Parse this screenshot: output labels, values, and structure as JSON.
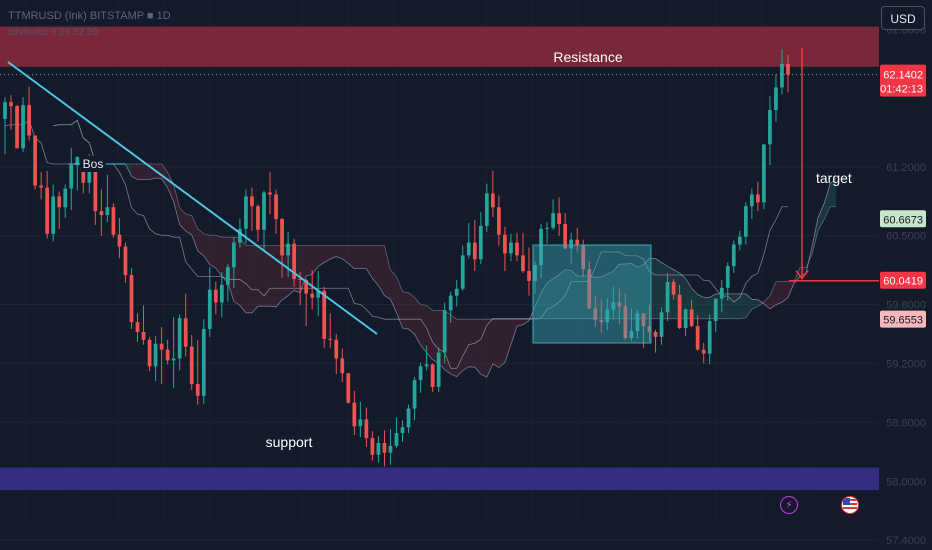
{
  "header": {
    "symbol_line": "TTMRUSD (Ink) BITSTAMP ■ 1D",
    "indicator_line": "Ichimoku 9 26 52 26"
  },
  "currency_button": "USD",
  "annotations": {
    "resistance": "Resistance",
    "support": "support",
    "bos": "Bos",
    "target": "target"
  },
  "price_labels": {
    "last": "62.1402",
    "countdown": "01:42:13",
    "line_a": "60.6673",
    "target_price": "60.0419",
    "line_b": "59.6553"
  },
  "bottom_icons": [
    "lightning-icon",
    "us-flag-icon"
  ],
  "colors": {
    "background": "#131a2a",
    "bull": "#26a69a",
    "bear": "#ef5350",
    "resistance_zone": "#8d2a3c",
    "support_zone": "#3a2f8a",
    "trendline": "#4fc3e4",
    "consolidation_box": "#3aa6b8",
    "target_marker": "#f23645",
    "label_green": "#c8e6c9",
    "label_red": "#f23645",
    "label_pink": "#f7b9b9"
  },
  "chart_data": {
    "type": "candlestick",
    "ylim": [
      57.3,
      62.9
    ],
    "resistance_zone": [
      62.22,
      62.63
    ],
    "support_zone": [
      57.91,
      58.14
    ],
    "target_level": 60.0419,
    "price_lines": [
      62.1402,
      60.6673,
      60.0419,
      59.6553
    ],
    "y_axis_ticks": [
      62.6,
      61.2,
      60.5,
      59.8,
      59.2,
      58.6,
      58.0,
      57.4
    ],
    "x_axis_ticks": [
      "",
      "",
      "",
      "",
      "",
      "",
      "",
      "",
      "",
      "",
      "",
      "",
      "",
      "",
      "",
      "",
      "",
      ""
    ],
    "candles_ohlc": [
      [
        61.69,
        61.91,
        61.33,
        61.86
      ],
      [
        61.86,
        61.93,
        61.58,
        61.82
      ],
      [
        61.82,
        61.83,
        61.41,
        61.39
      ],
      [
        61.39,
        61.91,
        61.35,
        61.83
      ],
      [
        61.83,
        62.02,
        61.47,
        61.52
      ],
      [
        61.52,
        61.52,
        60.97,
        61.01
      ],
      [
        61.01,
        61.15,
        60.87,
        60.99
      ],
      [
        60.99,
        61.16,
        60.47,
        60.52
      ],
      [
        60.52,
        61.02,
        60.44,
        60.9
      ],
      [
        60.9,
        60.95,
        60.57,
        60.79
      ],
      [
        60.79,
        61.02,
        60.68,
        60.98
      ],
      [
        60.98,
        61.39,
        60.76,
        61.22
      ],
      [
        61.22,
        61.31,
        60.96,
        61.3
      ],
      [
        61.3,
        61.3,
        60.93,
        61.04
      ],
      [
        61.04,
        61.33,
        60.93,
        61.2
      ],
      [
        61.2,
        61.24,
        60.61,
        60.75
      ],
      [
        60.75,
        60.97,
        60.5,
        60.71
      ],
      [
        60.71,
        61.12,
        60.64,
        60.79
      ],
      [
        60.79,
        60.83,
        60.48,
        60.51
      ],
      [
        60.51,
        60.68,
        60.27,
        60.39
      ],
      [
        60.39,
        60.43,
        60.02,
        60.1
      ],
      [
        60.1,
        60.17,
        59.55,
        59.62
      ],
      [
        59.62,
        59.71,
        59.42,
        59.52
      ],
      [
        59.52,
        59.79,
        59.39,
        59.44
      ],
      [
        59.44,
        59.47,
        59.12,
        59.17
      ],
      [
        59.17,
        59.48,
        59.02,
        59.4
      ],
      [
        59.4,
        59.57,
        58.99,
        59.34
      ],
      [
        59.34,
        59.44,
        59.19,
        59.23
      ],
      [
        59.23,
        59.67,
        58.95,
        59.25
      ],
      [
        59.25,
        59.7,
        59.13,
        59.66
      ],
      [
        59.66,
        59.91,
        59.27,
        59.37
      ],
      [
        59.37,
        59.49,
        58.93,
        58.99
      ],
      [
        58.99,
        59.44,
        58.78,
        58.87
      ],
      [
        58.87,
        59.65,
        58.79,
        59.55
      ],
      [
        59.55,
        60.18,
        59.47,
        59.95
      ],
      [
        59.95,
        60.03,
        59.7,
        59.82
      ],
      [
        59.82,
        60.13,
        59.67,
        60.0
      ],
      [
        60.0,
        60.21,
        59.83,
        60.18
      ],
      [
        60.18,
        60.49,
        59.97,
        60.43
      ],
      [
        60.43,
        60.67,
        60.38,
        60.57
      ],
      [
        60.57,
        60.97,
        60.42,
        60.9
      ],
      [
        60.9,
        60.99,
        60.55,
        60.8
      ],
      [
        60.8,
        60.82,
        60.44,
        60.56
      ],
      [
        60.56,
        60.96,
        60.36,
        60.94
      ],
      [
        60.94,
        61.15,
        60.72,
        60.92
      ],
      [
        60.92,
        60.97,
        60.52,
        60.67
      ],
      [
        60.67,
        60.68,
        60.07,
        60.3
      ],
      [
        60.3,
        60.54,
        60.08,
        60.42
      ],
      [
        60.42,
        60.47,
        59.98,
        60.06
      ],
      [
        60.06,
        60.13,
        59.79,
        60.05
      ],
      [
        60.05,
        60.06,
        59.58,
        59.91
      ],
      [
        59.91,
        60.15,
        59.75,
        59.87
      ],
      [
        59.87,
        60.14,
        59.68,
        59.94
      ],
      [
        59.94,
        59.98,
        59.36,
        59.45
      ],
      [
        59.45,
        59.71,
        59.36,
        59.44
      ],
      [
        59.44,
        59.5,
        59.09,
        59.25
      ],
      [
        59.25,
        59.35,
        59.01,
        59.1
      ],
      [
        59.1,
        59.1,
        58.79,
        58.8
      ],
      [
        58.8,
        58.92,
        58.47,
        58.56
      ],
      [
        58.56,
        58.81,
        58.45,
        58.63
      ],
      [
        58.63,
        58.75,
        58.35,
        58.44
      ],
      [
        58.44,
        58.51,
        58.21,
        58.27
      ],
      [
        58.27,
        58.46,
        58.19,
        58.39
      ],
      [
        58.39,
        58.52,
        58.15,
        58.29
      ],
      [
        58.29,
        58.53,
        58.17,
        58.36
      ],
      [
        58.36,
        58.65,
        58.34,
        58.49
      ],
      [
        58.49,
        58.62,
        58.4,
        58.55
      ],
      [
        58.55,
        58.78,
        58.49,
        58.74
      ],
      [
        58.74,
        59.06,
        58.62,
        59.03
      ],
      [
        59.03,
        59.21,
        58.9,
        59.17
      ],
      [
        59.17,
        59.38,
        59.13,
        59.19
      ],
      [
        59.19,
        59.2,
        58.91,
        58.96
      ],
      [
        58.96,
        59.36,
        58.91,
        59.31
      ],
      [
        59.31,
        59.82,
        59.2,
        59.74
      ],
      [
        59.74,
        59.93,
        59.61,
        59.89
      ],
      [
        59.89,
        60.05,
        59.78,
        59.96
      ],
      [
        59.96,
        60.4,
        59.94,
        60.3
      ],
      [
        60.3,
        60.63,
        60.27,
        60.43
      ],
      [
        60.43,
        60.66,
        60.14,
        60.26
      ],
      [
        60.26,
        60.74,
        60.21,
        60.6
      ],
      [
        60.6,
        61.03,
        60.54,
        60.93
      ],
      [
        60.93,
        61.16,
        60.69,
        60.79
      ],
      [
        60.79,
        60.91,
        60.4,
        60.51
      ],
      [
        60.51,
        60.59,
        60.14,
        60.32
      ],
      [
        60.32,
        60.52,
        60.24,
        60.43
      ],
      [
        60.43,
        60.53,
        60.24,
        60.3
      ],
      [
        60.3,
        60.53,
        60.12,
        60.14
      ],
      [
        60.14,
        60.38,
        59.89,
        60.04
      ],
      [
        60.04,
        60.24,
        59.91,
        60.2
      ],
      [
        60.2,
        60.62,
        60.07,
        60.57
      ],
      [
        60.57,
        60.64,
        60.42,
        60.58
      ],
      [
        60.58,
        60.87,
        60.56,
        60.73
      ],
      [
        60.73,
        60.89,
        60.5,
        60.62
      ],
      [
        60.62,
        60.73,
        60.36,
        60.37
      ],
      [
        60.37,
        60.53,
        60.21,
        60.46
      ],
      [
        60.46,
        60.58,
        60.34,
        60.41
      ],
      [
        60.41,
        60.46,
        60.08,
        60.16
      ],
      [
        60.16,
        60.24,
        59.75,
        59.76
      ],
      [
        59.76,
        59.88,
        59.57,
        59.64
      ],
      [
        59.64,
        59.85,
        59.51,
        59.62
      ],
      [
        59.62,
        59.86,
        59.54,
        59.75
      ],
      [
        59.75,
        59.98,
        59.65,
        59.82
      ],
      [
        59.82,
        59.96,
        59.6,
        59.78
      ],
      [
        59.78,
        59.91,
        59.44,
        59.46
      ],
      [
        59.46,
        59.76,
        59.43,
        59.53
      ],
      [
        59.53,
        59.74,
        59.45,
        59.71
      ],
      [
        59.71,
        59.71,
        59.36,
        59.58
      ],
      [
        59.58,
        59.8,
        59.42,
        59.52
      ],
      [
        59.52,
        59.54,
        59.31,
        59.47
      ],
      [
        59.47,
        59.77,
        59.39,
        59.72
      ],
      [
        59.72,
        60.12,
        59.63,
        60.03
      ],
      [
        60.03,
        60.06,
        59.85,
        59.9
      ],
      [
        59.9,
        60.0,
        59.55,
        59.56
      ],
      [
        59.56,
        59.76,
        59.48,
        59.75
      ],
      [
        59.75,
        59.85,
        59.57,
        59.58
      ],
      [
        59.58,
        59.69,
        59.33,
        59.34
      ],
      [
        59.34,
        59.41,
        59.2,
        59.3
      ],
      [
        59.3,
        59.7,
        59.19,
        59.63
      ],
      [
        59.63,
        59.86,
        59.52,
        59.86
      ],
      [
        59.86,
        60.05,
        59.72,
        59.97
      ],
      [
        59.97,
        60.23,
        59.84,
        60.19
      ],
      [
        60.19,
        60.45,
        60.12,
        60.41
      ],
      [
        60.41,
        60.55,
        60.35,
        60.49
      ],
      [
        60.49,
        60.84,
        60.41,
        60.8
      ],
      [
        60.8,
        60.98,
        60.67,
        60.92
      ],
      [
        60.92,
        61.05,
        60.75,
        60.84
      ],
      [
        60.84,
        61.43,
        60.77,
        61.43
      ],
      [
        61.43,
        61.92,
        61.22,
        61.78
      ],
      [
        61.78,
        62.14,
        61.66,
        62.01
      ],
      [
        62.01,
        62.4,
        61.94,
        62.25
      ],
      [
        62.25,
        62.34,
        61.96,
        62.14
      ]
    ]
  }
}
